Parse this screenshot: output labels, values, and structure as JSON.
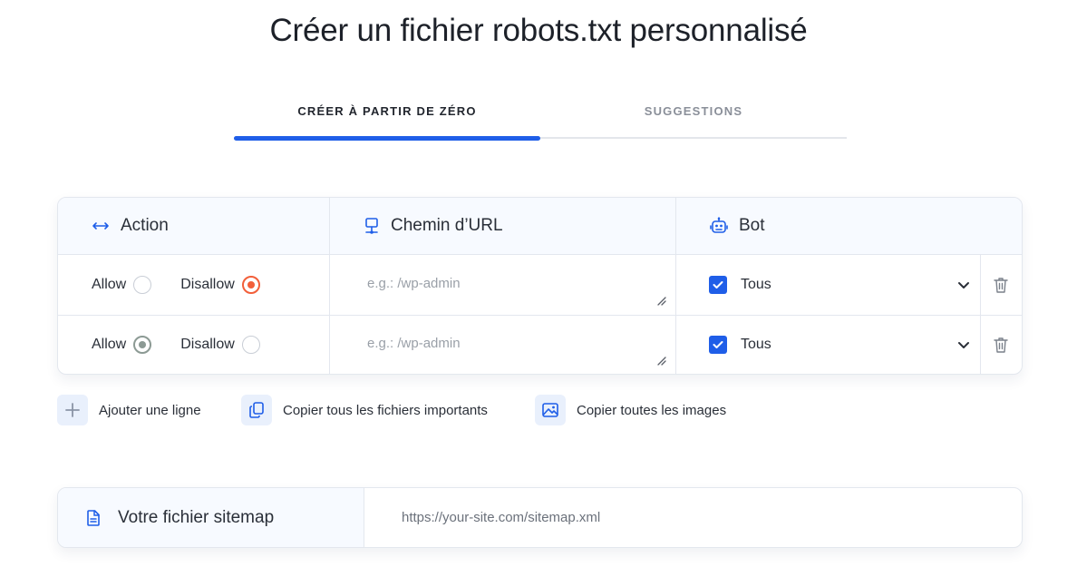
{
  "page": {
    "title": "Créer un fichier robots.txt personnalisé"
  },
  "tabs": [
    {
      "label": "CRÉER À PARTIR DE ZÉRO",
      "active": true
    },
    {
      "label": "SUGGESTIONS",
      "active": false
    }
  ],
  "table": {
    "headers": {
      "action": {
        "label": "Action",
        "icon": "arrows-horizontal-icon"
      },
      "url": {
        "label": "Chemin d’URL",
        "icon": "network-icon"
      },
      "bot": {
        "label": "Bot",
        "icon": "robot-icon"
      }
    },
    "rows": [
      {
        "allow_label": "Allow",
        "disallow_label": "Disallow",
        "selected": "Disallow",
        "url_value": "",
        "url_placeholder": "e.g.: /wp-admin",
        "bot_checked": true,
        "bot_label": "Tous"
      },
      {
        "allow_label": "Allow",
        "disallow_label": "Disallow",
        "selected": "Allow",
        "url_value": "",
        "url_placeholder": "e.g.: /wp-admin",
        "bot_checked": true,
        "bot_label": "Tous"
      }
    ]
  },
  "actions": {
    "add_row": {
      "label": "Ajouter une ligne",
      "icon": "plus-icon"
    },
    "copy_files": {
      "label": "Copier tous les fichiers importants",
      "icon": "copy-icon"
    },
    "copy_images": {
      "label": "Copier toutes les images",
      "icon": "image-icon"
    }
  },
  "sitemap": {
    "label": "Votre fichier sitemap",
    "icon": "document-icon",
    "value": "",
    "placeholder": "https://your-site.com/sitemap.xml"
  },
  "colors": {
    "accent": "#1f5ee8",
    "disallow_radio": "#f25f3a",
    "allow_radio": "#8c9a94",
    "header_bg": "#f7faff",
    "border": "#e3e7ee"
  }
}
